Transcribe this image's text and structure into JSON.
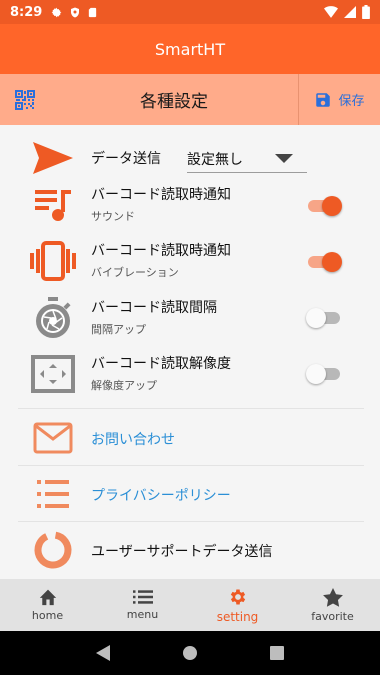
{
  "status_bar": {
    "time": "8:29"
  },
  "app_bar": {
    "title": "SmartHT"
  },
  "sub_header": {
    "title": "各種設定",
    "save_label": "保存"
  },
  "settings": {
    "data_send": {
      "label": "データ送信",
      "selected": "設定無し"
    },
    "sound_notify": {
      "label": "バーコード読取時通知",
      "sub": "サウンド",
      "enabled": true
    },
    "vibration_notify": {
      "label": "バーコード読取時通知",
      "sub": "バイブレーション",
      "enabled": true
    },
    "interval": {
      "label": "バーコード読取間隔",
      "sub": "間隔アップ",
      "enabled": false
    },
    "resolution": {
      "label": "バーコード読取解像度",
      "sub": "解像度アップ",
      "enabled": false
    }
  },
  "links": {
    "contact": "お問い合わせ",
    "privacy": "プライバシーポリシー",
    "support": "ユーザーサポートデータ送信"
  },
  "bottom_nav": [
    {
      "label": "home",
      "icon": "home-icon"
    },
    {
      "label": "menu",
      "icon": "list-icon"
    },
    {
      "label": "setting",
      "icon": "gear-icon",
      "active": true
    },
    {
      "label": "favorite",
      "icon": "star-icon"
    }
  ],
  "colors": {
    "primary": "#ff6529",
    "accent": "#ee5a24",
    "subheader": "#ffab8a",
    "link": "#2b8fd6",
    "save": "#2a6fdb"
  }
}
